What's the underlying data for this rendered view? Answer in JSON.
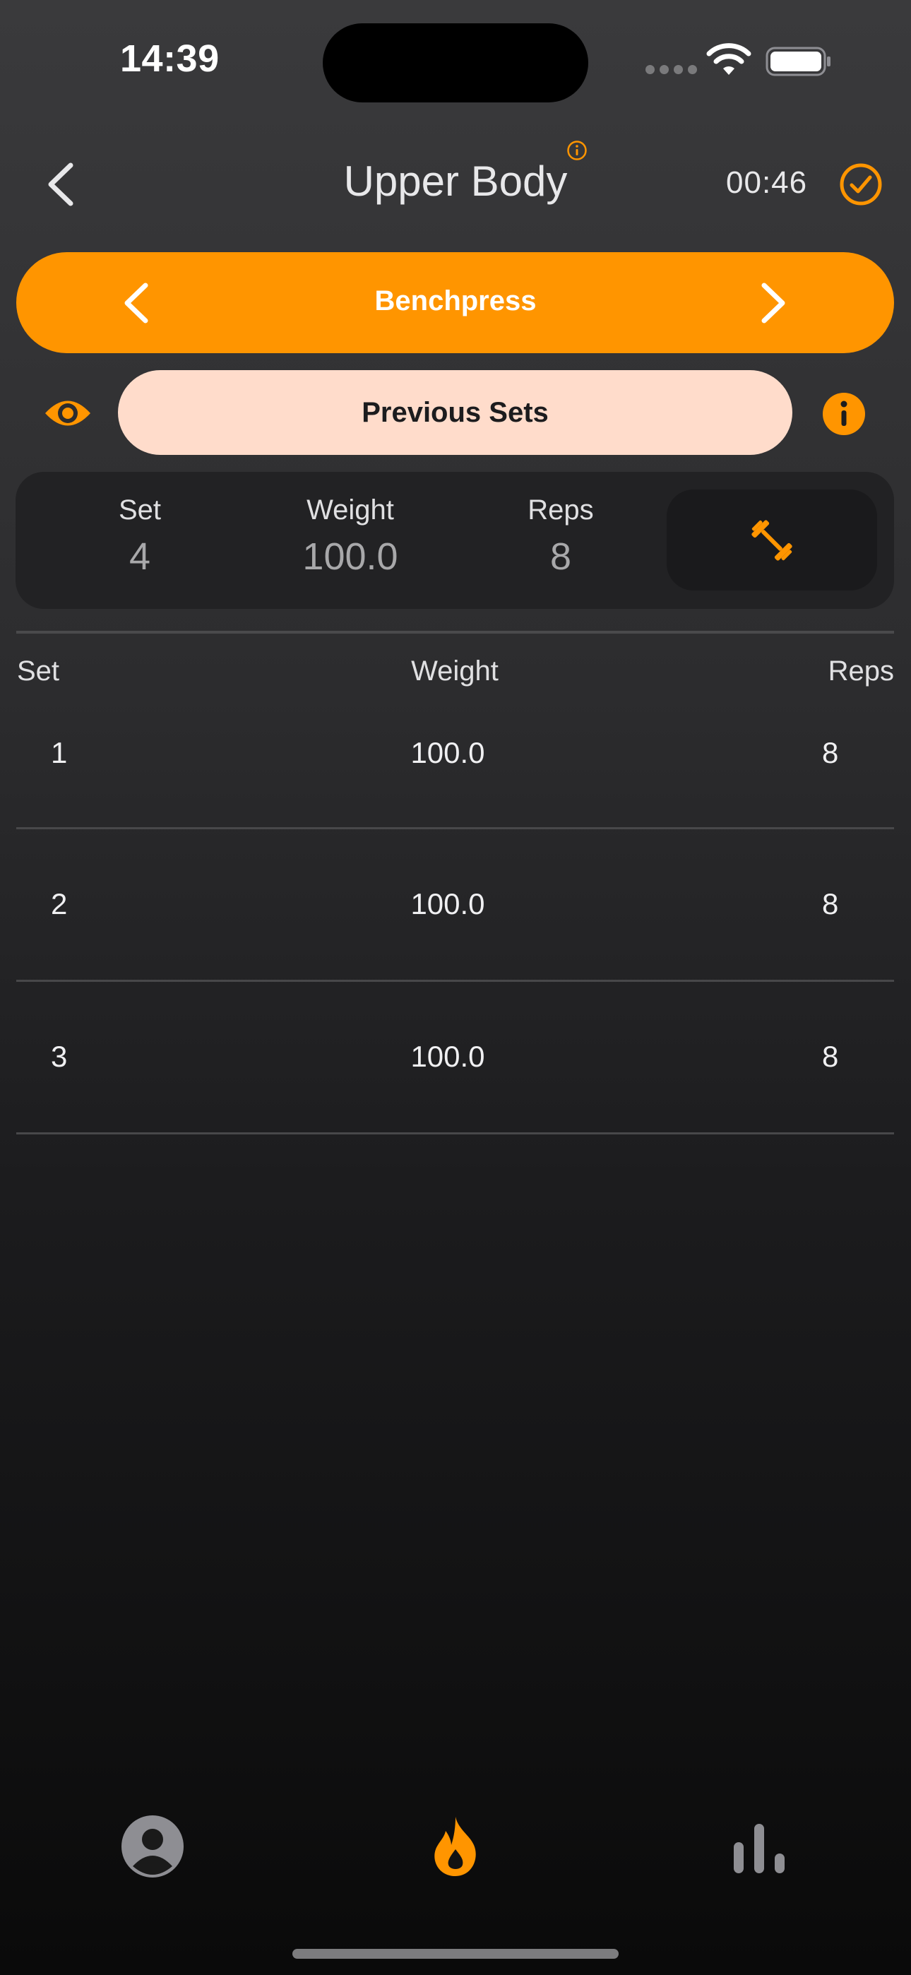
{
  "status_bar": {
    "time": "14:39",
    "icons": [
      "cellular-signal-icon",
      "wifi-icon",
      "battery-icon"
    ]
  },
  "header": {
    "title": "Upper Body",
    "timer": "00:46",
    "icons": [
      "chevron-left-icon",
      "info-circle-icon",
      "checkmark-circle-icon"
    ]
  },
  "exercise": {
    "name": "Benchpress",
    "icons": [
      "chevron-left-icon",
      "chevron-right-icon"
    ]
  },
  "previous_sets": {
    "button_label": "Previous Sets",
    "icons": [
      "eye-icon",
      "info-icon"
    ]
  },
  "current_set": {
    "set_label": "Set",
    "set_value": "4",
    "weight_label": "Weight",
    "weight_value": "100.0",
    "reps_label": "Reps",
    "reps_value": "8",
    "log_icon": "dumbbell-icon"
  },
  "table": {
    "headers": {
      "set": "Set",
      "weight": "Weight",
      "reps": "Reps"
    },
    "rows": [
      {
        "set": "1",
        "weight": "100.0",
        "reps": "8"
      },
      {
        "set": "2",
        "weight": "100.0",
        "reps": "8"
      },
      {
        "set": "3",
        "weight": "100.0",
        "reps": "8"
      }
    ]
  },
  "tab_bar": {
    "tabs": [
      {
        "icon": "person-circle-icon",
        "active": false
      },
      {
        "icon": "flame-icon",
        "active": true
      },
      {
        "icon": "bar-chart-icon",
        "active": false
      }
    ]
  },
  "colors": {
    "accent": "#ff9500",
    "accent_light": "#ffdccb",
    "card": "#222224",
    "inactive_icon": "#8e8e93"
  }
}
